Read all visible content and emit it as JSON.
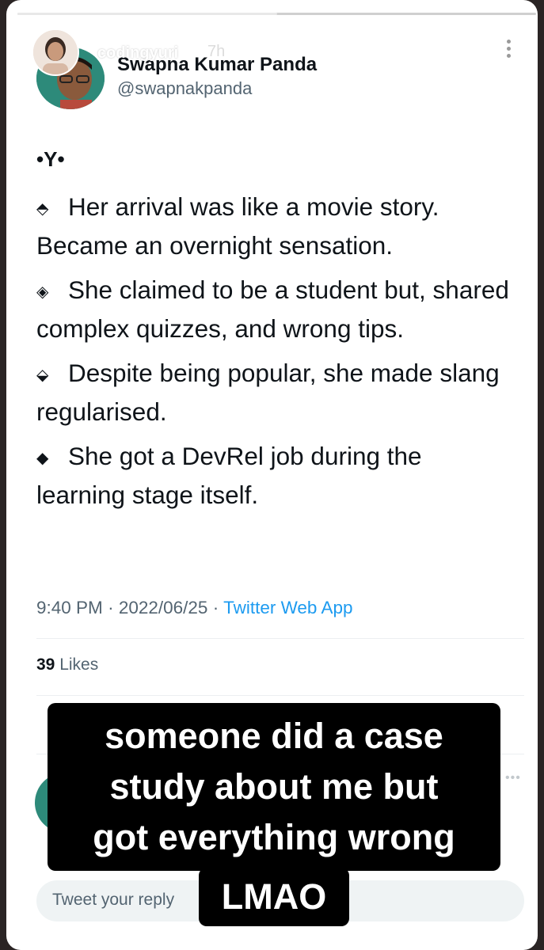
{
  "story": {
    "username": "codingyuri",
    "time": "7h",
    "progress": 0.5
  },
  "tweet": {
    "author_name": "Swapna Kumar Panda",
    "author_handle": "@swapnakpanda",
    "intro": "•Y•",
    "points": [
      {
        "icon": "⬘",
        "text": "Her arrival was like a movie story. Became an overnight sensation."
      },
      {
        "icon": "◈",
        "text": "She claimed to be a student but, shared complex quizzes, and wrong tips."
      },
      {
        "icon": "⬙",
        "text": "Despite being popular, she made slang regularised."
      },
      {
        "icon": "◆",
        "text": "She got a DevRel job during the learning stage itself."
      }
    ],
    "time": "9:40 PM",
    "date": "2022/06/25",
    "source": "Twitter Web App",
    "likes_count": "39",
    "likes_label": "Likes"
  },
  "reply": {
    "placeholder": "Tweet your reply"
  },
  "caption": {
    "lines": [
      "someone did a case",
      "study about me but",
      "got everything wrong"
    ],
    "tail": "LMAO"
  },
  "colors": {
    "link": "#1d9bf0",
    "caption_bg": "#000000",
    "avatar_bg": "#2d8a7a"
  }
}
